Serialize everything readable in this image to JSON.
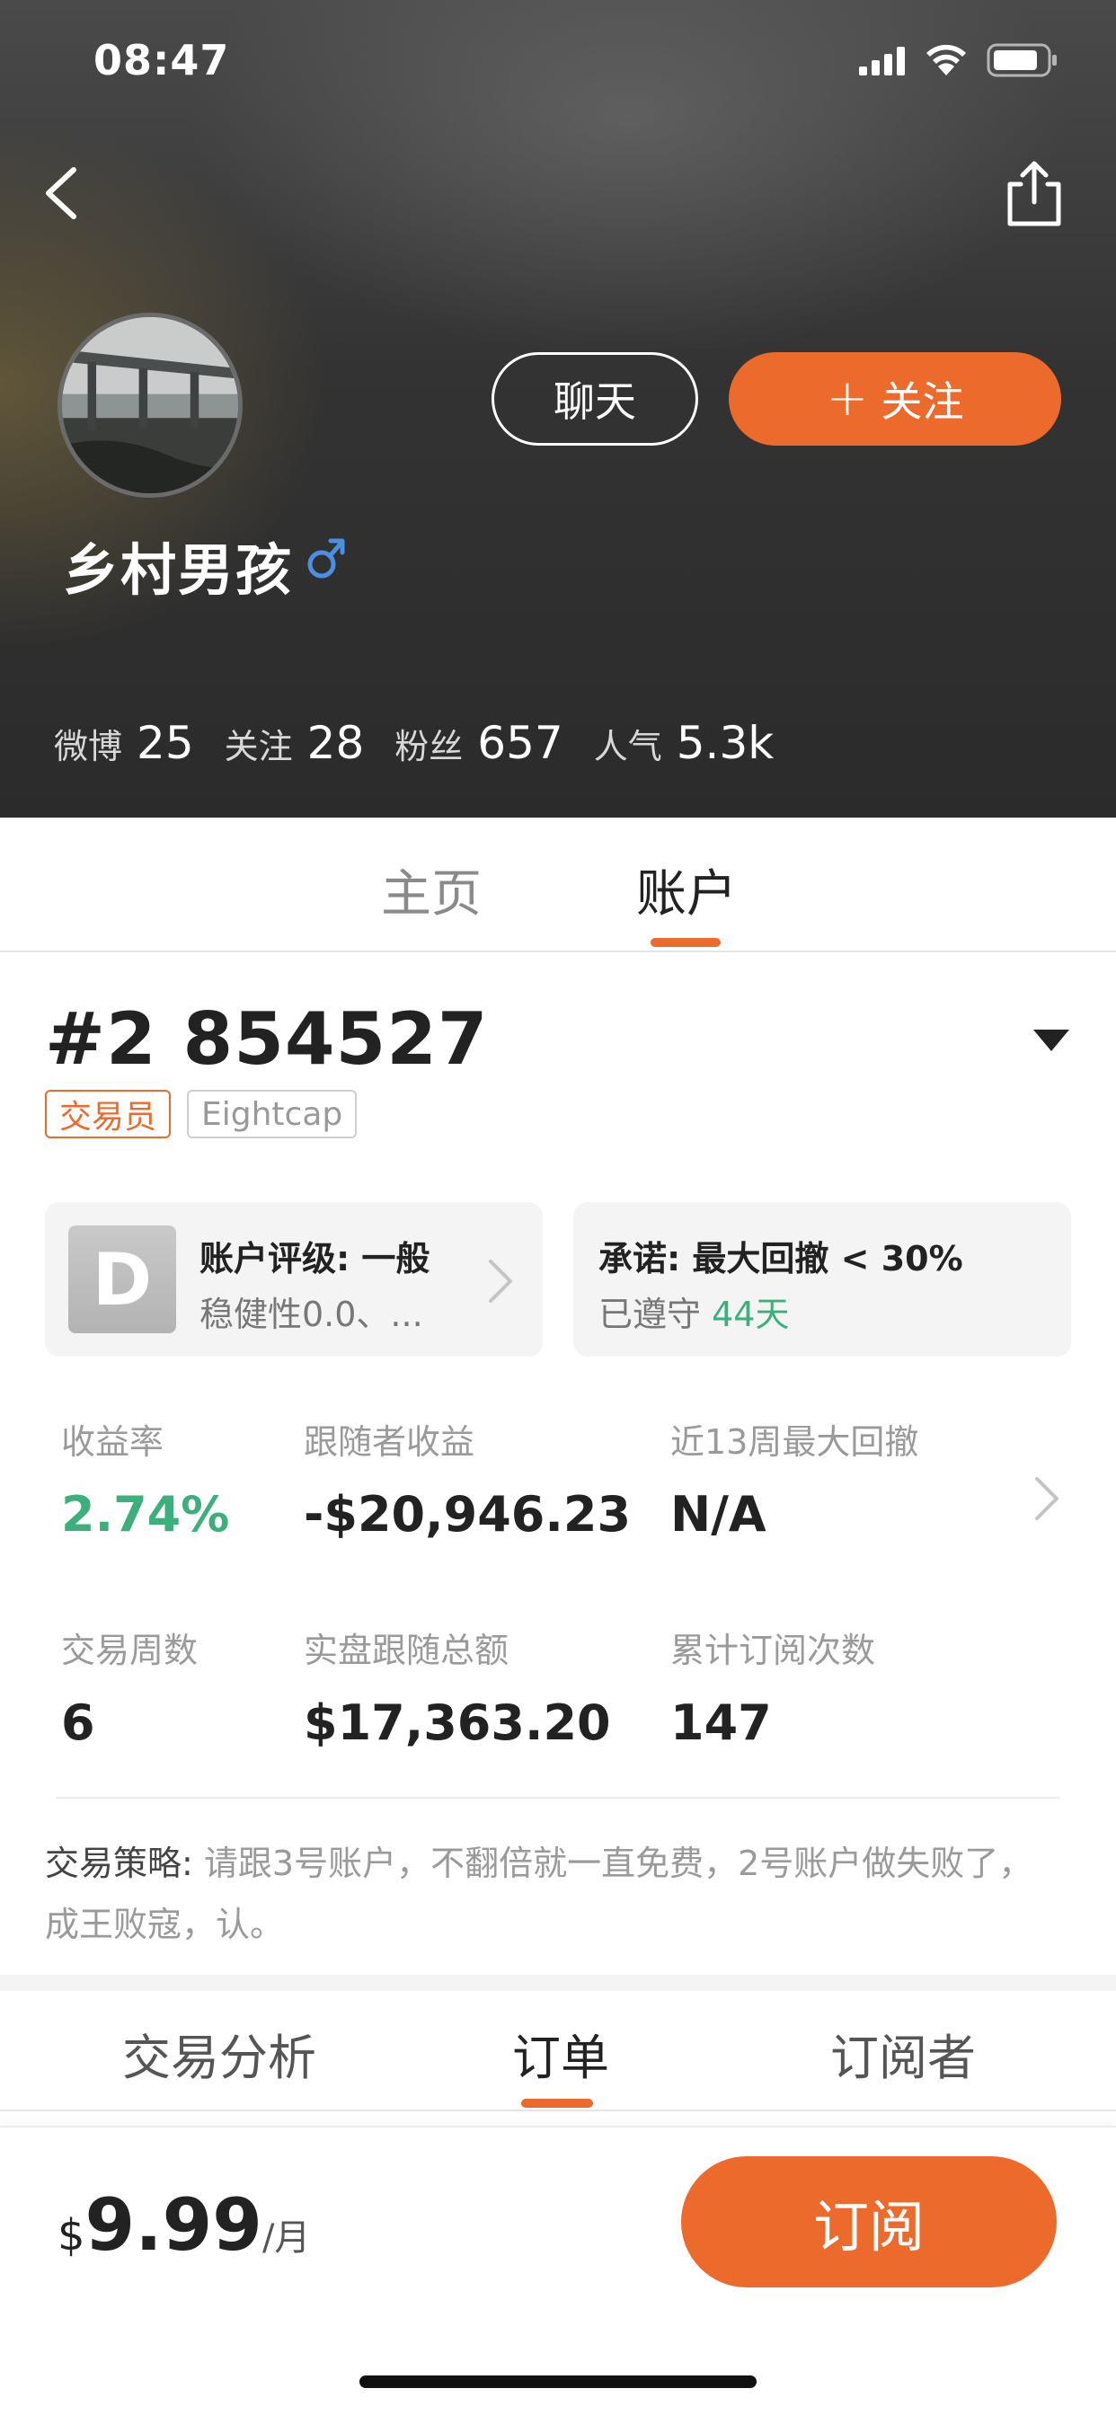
{
  "status_bar": {
    "time": "08:47"
  },
  "profile": {
    "name": "乡村男孩",
    "chat_label": "聊天",
    "follow_label": "关注",
    "follow_plus": "+",
    "stats": [
      {
        "label": "微博",
        "value": "25"
      },
      {
        "label": "关注",
        "value": "28"
      },
      {
        "label": "粉丝",
        "value": "657"
      },
      {
        "label": "人气",
        "value": "5.3k"
      }
    ]
  },
  "main_tabs": [
    {
      "label": "主页",
      "active": false
    },
    {
      "label": "账户",
      "active": true
    }
  ],
  "account": {
    "id": "#2 854527",
    "tags": [
      "交易员",
      "Eightcap"
    ],
    "rating_card": {
      "grade": "D",
      "title": "账户评级: 一般",
      "subtitle": "稳健性0.0、..."
    },
    "promise_card": {
      "title": "承诺: 最大回撤 < 30%",
      "subtitle_prefix": "已遵守",
      "subtitle_days": "44天"
    },
    "metrics": [
      {
        "label": "收益率",
        "value": "2.74%"
      },
      {
        "label": "跟随者收益",
        "value": "-$20,946.23"
      },
      {
        "label": "近13周最大回撤",
        "value": "N/A"
      },
      {
        "label": "交易周数",
        "value": "6"
      },
      {
        "label": "实盘跟随总额",
        "value": "$17,363.20"
      },
      {
        "label": "累计订阅次数",
        "value": "147"
      }
    ],
    "strategy_label": "交易策略:",
    "strategy_text": " 请跟3号账户，不翻倍就一直免费，2号账户做失败了，成王败寇，认。"
  },
  "sub_tabs": [
    {
      "label": "交易分析",
      "active": false
    },
    {
      "label": "订单",
      "active": true
    },
    {
      "label": "订阅者",
      "active": false
    }
  ],
  "bottom_bar": {
    "currency": "$",
    "price": "9.99",
    "unit": "/月",
    "subscribe_label": "订阅"
  },
  "colors": {
    "accent": "#ec6a2c",
    "positive": "#3daf7a",
    "gender": "#4a90e2"
  },
  "icons": [
    "signal-icon",
    "wifi-icon",
    "battery-icon",
    "back-arrow-icon",
    "share-icon",
    "male-gender-icon",
    "dropdown-triangle-icon",
    "chevron-right-icon"
  ]
}
